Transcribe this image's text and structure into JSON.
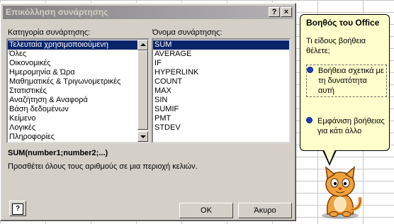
{
  "dialog": {
    "title": "Επικόλληση συνάρτησης",
    "help_button": "?",
    "close_button": "×",
    "category_label": "Κατηγορία συνάρτησης:",
    "categories": [
      "Τελευταία χρησιμοποιούμενη",
      "Όλες",
      "Οικονομικές",
      "Ημερομηνία & Ώρα",
      "Μαθηματικές & Τριγωνομετρικές",
      "Στατιστικές",
      "Αναζήτηση & Αναφορά",
      "Βάση δεδομένων",
      "Κείμενο",
      "Λογικές",
      "Πληροφορίες"
    ],
    "selected_category_index": 0,
    "function_label": "Όνομα συνάρτησης:",
    "functions": [
      "SUM",
      "AVERAGE",
      "IF",
      "HYPERLINK",
      "COUNT",
      "MAX",
      "SIN",
      "SUMIF",
      "PMT",
      "STDEV"
    ],
    "selected_function_index": 0,
    "syntax": "SUM(number1;number2;...)",
    "description": "Προσθέτει όλους τους αριθμούς σε μια περιοχή κελιών.",
    "ok_label": "OK",
    "cancel_label": "Άκυρο",
    "office_help_icon": "question-mark-icon"
  },
  "assistant": {
    "title": "Βοηθός του Office",
    "question": "Τι είδους βοήθεια θέλετε;",
    "options": [
      "Βοήθεια σχετικά με τη δυνατότητα αυτή",
      "Εμφάνιση βοήθειας για κάτι άλλο"
    ],
    "character": "office-cat-assistant"
  }
}
